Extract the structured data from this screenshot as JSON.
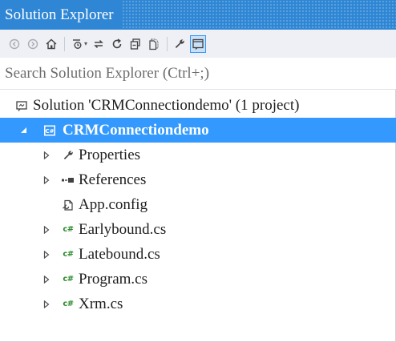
{
  "panel": {
    "title": "Solution Explorer"
  },
  "toolbar": {
    "buttons": [
      {
        "icon": "back-icon"
      },
      {
        "icon": "forward-icon"
      },
      {
        "icon": "home-icon"
      },
      {
        "icon": "pending-changes-filter-icon"
      },
      {
        "icon": "sync-with-active-document-icon"
      },
      {
        "icon": "refresh-icon"
      },
      {
        "icon": "collapse-all-icon"
      },
      {
        "icon": "show-all-files-icon"
      },
      {
        "icon": "properties-icon"
      },
      {
        "icon": "preview-selected-items-icon"
      }
    ]
  },
  "search": {
    "placeholder": "Search Solution Explorer (Ctrl+;)"
  },
  "tree": {
    "solution": {
      "label": "Solution 'CRMConnectiondemo' (1 project)",
      "icon": "solution-icon"
    },
    "project": {
      "label": "CRMConnectiondemo",
      "icon": "csharp-project-icon",
      "expanded": true,
      "selected": true
    },
    "items": [
      {
        "label": "Properties",
        "icon": "wrench-icon",
        "expandable": true
      },
      {
        "label": "References",
        "icon": "references-icon",
        "expandable": true
      },
      {
        "label": "App.config",
        "icon": "config-file-icon",
        "expandable": false
      },
      {
        "label": "Earlybound.cs",
        "icon": "csharp-file-icon",
        "expandable": true
      },
      {
        "label": "Latebound.cs",
        "icon": "csharp-file-icon",
        "expandable": true
      },
      {
        "label": "Program.cs",
        "icon": "csharp-file-icon",
        "expandable": true
      },
      {
        "label": "Xrm.cs",
        "icon": "csharp-file-icon",
        "expandable": true
      }
    ]
  },
  "colors": {
    "title_bar": "#2f86d4",
    "selection": "#3399ff",
    "toolbar_bg": "#eef0f5"
  }
}
